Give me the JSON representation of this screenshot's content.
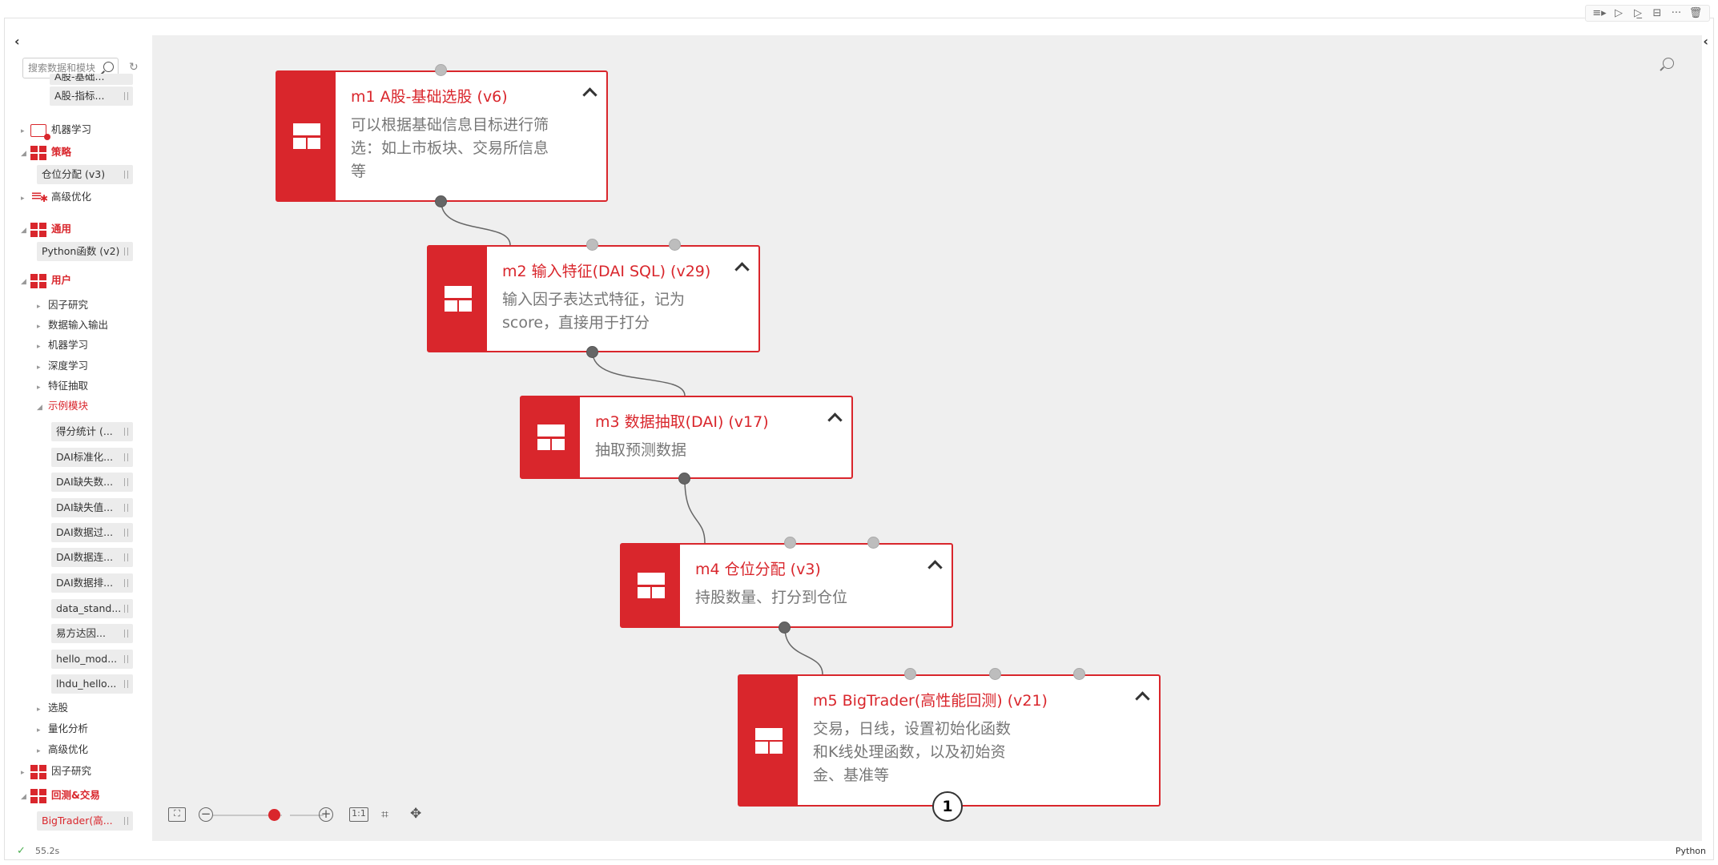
{
  "toolbar": {
    "icons": [
      "≡▸",
      "▷",
      "▷̲",
      "⊟",
      "···",
      "🗑"
    ]
  },
  "sidebar": {
    "search_placeholder": "搜索数据和模块",
    "items": {
      "truncated_top": "A股-基础...",
      "a_index": "A股-指标...",
      "ml": "机器学习",
      "strategy": "策略",
      "position_alloc": "仓位分配 (v3)",
      "advanced_opt": "高级优化",
      "general": "通用",
      "python_func": "Python函数 (v2)",
      "user": "用户",
      "factor_research": "因子研究",
      "data_io": "数据输入输出",
      "ml2": "机器学习",
      "deep_learning": "深度学习",
      "feature_extract": "特征抽取",
      "examples": "示例模块",
      "score_stats": "得分统计 (...",
      "dai_std": "DAI标准化...",
      "dai_missing1": "DAI缺失数...",
      "dai_missing2": "DAI缺失值...",
      "dai_filter": "DAI数据过...",
      "dai_concat": "DAI数据连...",
      "dai_sort": "DAI数据排...",
      "data_stand": "data_stand...",
      "efund": "易方达因...",
      "hello_mod": "hello_mod...",
      "lhdu_hello": "lhdu_hello...",
      "stock_select": "选股",
      "quant_analysis": "量化分析",
      "advanced_opt2": "高级优化",
      "factor_research2": "因子研究",
      "backtest_trade": "回测&交易",
      "bigtrader": "BigTrader(高..."
    }
  },
  "nodes": [
    {
      "title": "m1 A股-基础选股 (v6)",
      "desc": [
        "可以根据基础信息目标进行筛",
        "选：如上市板块、交易所信息",
        "等"
      ]
    },
    {
      "title": "m2 输入特征(DAI SQL) (v29)",
      "desc": [
        "输入因子表达式特征，记为",
        "score，直接用于打分"
      ]
    },
    {
      "title": "m3 数据抽取(DAI) (v17)",
      "desc": [
        "抽取预测数据"
      ]
    },
    {
      "title": "m4 仓位分配 (v3)",
      "desc": [
        "持股数量、打分到仓位"
      ]
    },
    {
      "title": "m5 BigTrader(高性能回测) (v21)",
      "desc": [
        "交易，日线，设置初始化函数",
        "和K线处理函数，以及初始资",
        "金、基准等"
      ]
    }
  ],
  "badge": "1",
  "zoom": {
    "level": 0.55,
    "fit_label": "1:1"
  },
  "status": {
    "elapsed": "55.2s",
    "language": "Python"
  },
  "colors": {
    "accent": "#d9262c",
    "canvas": "#efefef"
  }
}
